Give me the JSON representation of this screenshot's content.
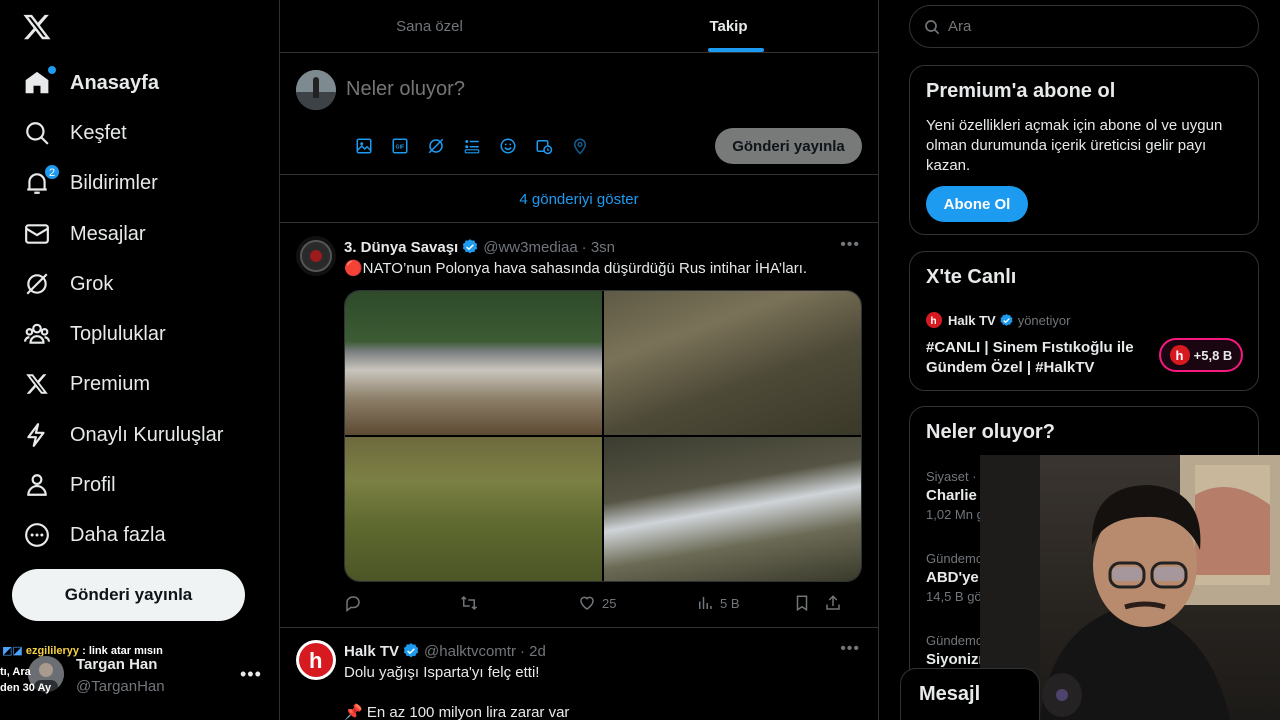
{
  "nav": {
    "items": [
      {
        "label": "Anasayfa",
        "icon": "home-icon",
        "active": true
      },
      {
        "label": "Keşfet",
        "icon": "search-icon"
      },
      {
        "label": "Bildirimler",
        "icon": "bell-icon",
        "badge": "2"
      },
      {
        "label": "Mesajlar",
        "icon": "mail-icon"
      },
      {
        "label": "Grok",
        "icon": "grok-icon"
      },
      {
        "label": "Topluluklar",
        "icon": "communities-icon"
      },
      {
        "label": "Premium",
        "icon": "x-logo-icon"
      },
      {
        "label": "Onaylı Kuruluşlar",
        "icon": "lightning-icon"
      },
      {
        "label": "Profil",
        "icon": "person-icon"
      },
      {
        "label": "Daha fazla",
        "icon": "more-circle-icon"
      }
    ],
    "post_button": "Gönderi yayınla"
  },
  "account": {
    "name": "Targan Han",
    "handle": "@TarganHan"
  },
  "stream_chat": {
    "user": "ezgilileryy",
    "message": " : link atar mısın",
    "side_lines": [
      "tı, Ara",
      "den 30 Ay"
    ]
  },
  "tabs": [
    {
      "label": "Sana özel",
      "active": false
    },
    {
      "label": "Takip",
      "active": true
    }
  ],
  "composer": {
    "placeholder": "Neler oluyor?",
    "post_button": "Gönderi yayınla"
  },
  "show_more": "4 gönderiyi göster",
  "tweets": [
    {
      "name": "3. Dünya Savaşı",
      "handle": "@ww3mediaa",
      "time": "· 3sn",
      "text": "🔴NATO’nun Polonya hava sahasında düşürdüğü Rus intihar İHA’ları.",
      "stats": {
        "likes": "25",
        "views": "5 B"
      }
    },
    {
      "name": "Halk TV",
      "handle": "@halktvcomtr",
      "time": "· 2d",
      "text": "Dolu yağışı Isparta'yı felç etti!",
      "text2": "📌 En az 100 milyon lira zarar var"
    }
  ],
  "search": {
    "placeholder": "Ara"
  },
  "premium": {
    "title": "Premium'a abone ol",
    "desc": "Yeni özellikleri açmak için abone ol ve uygun olman durumunda içerik üreticisi gelir payı kazan.",
    "button": "Abone Ol"
  },
  "live": {
    "title": "X'te Canlı",
    "host": "Halk TV",
    "role": "yönetiyor",
    "stream_title": "#CANLI | Sinem Fıstıkoğlu ile Gündem Özel | #HalkTV",
    "listeners": "+5,8 B"
  },
  "trends": {
    "title": "Neler oluyor?",
    "items": [
      {
        "category": "Siyaset · G",
        "title": "Charlie",
        "count": "1,02 Mn g"
      },
      {
        "category": "Gündemc",
        "title": "ABD'ye",
        "count": "14,5 B gö"
      },
      {
        "category": "Gündemc",
        "title": "Siyonizı",
        "count": ""
      }
    ]
  },
  "messages_bar": {
    "label": "Mesajl"
  },
  "colors": {
    "accent": "#1d9bf0",
    "background": "#000000",
    "border": "#2f3336",
    "live": "#f91880"
  }
}
